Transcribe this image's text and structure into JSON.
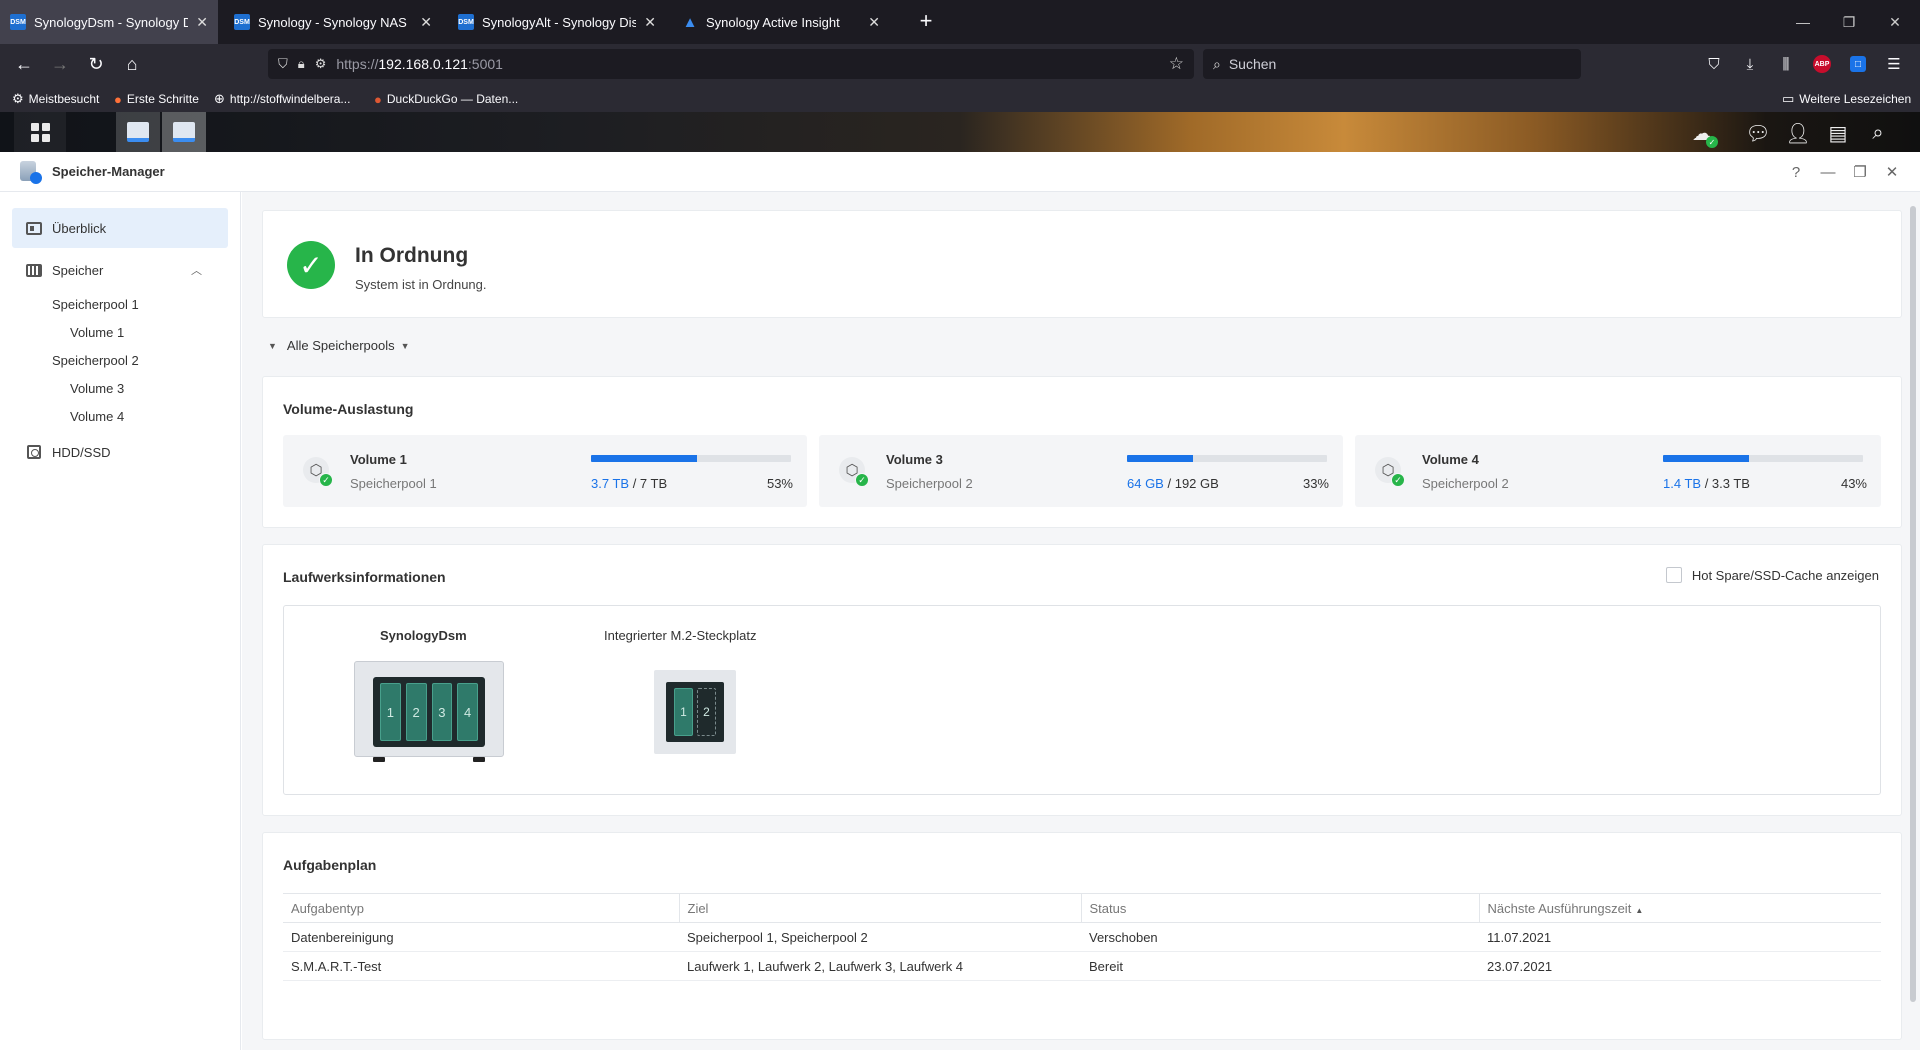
{
  "browser": {
    "tabs": [
      {
        "title": "SynologyDsm - Synology DiskStation",
        "icon": "DSM",
        "active": true
      },
      {
        "title": "Synology - Synology NAS",
        "icon": "DSM",
        "active": false
      },
      {
        "title": "SynologyAlt - Synology DiskStation",
        "icon": "DSM",
        "active": false
      },
      {
        "title": "Synology Active Insight",
        "icon": "insight-logo",
        "active": false
      }
    ],
    "url": {
      "scheme": "https://",
      "host": "192.168.0.121",
      "port": ":5001"
    },
    "search_placeholder": "Suchen",
    "bookmarks": [
      {
        "label": "Meistbesucht",
        "icon": "gear-icon"
      },
      {
        "label": "Erste Schritte",
        "icon": "firefox-icon"
      },
      {
        "label": "http://stoffwindelbera...",
        "icon": "globe-icon"
      },
      {
        "label": "DuckDuckGo — Daten...",
        "icon": "duckduckgo-icon"
      }
    ],
    "other_bookmarks": "Weitere Lesezeichen",
    "abp_label": "ABP"
  },
  "app": {
    "title": "Speicher-Manager"
  },
  "sidebar": {
    "overview": "Überblick",
    "storage": "Speicher",
    "pools": [
      {
        "label": "Speicherpool 1",
        "volumes": [
          "Volume 1"
        ]
      },
      {
        "label": "Speicherpool 2",
        "volumes": [
          "Volume 3",
          "Volume 4"
        ]
      }
    ],
    "hdd": "HDD/SSD"
  },
  "status": {
    "title": "In Ordnung",
    "subtitle": "System ist in Ordnung."
  },
  "pool_filter": "Alle Speicherpools",
  "volume_usage": {
    "title": "Volume-Auslastung",
    "volumes": [
      {
        "name": "Volume 1",
        "pool": "Speicherpool 1",
        "used": "3.7 TB",
        "total": "7 TB",
        "percent_label": "53%",
        "percent": 53
      },
      {
        "name": "Volume 3",
        "pool": "Speicherpool 2",
        "used": "64 GB",
        "total": "192 GB",
        "percent_label": "33%",
        "percent": 33
      },
      {
        "name": "Volume 4",
        "pool": "Speicherpool 2",
        "used": "1.4 TB",
        "total": "3.3 TB",
        "percent_label": "43%",
        "percent": 43
      }
    ]
  },
  "drives": {
    "title": "Laufwerksinformationen",
    "hotspare_label": "Hot Spare/SSD-Cache anzeigen",
    "nas_name": "SynologyDsm",
    "nas_bays": [
      "1",
      "2",
      "3",
      "4"
    ],
    "m2_name": "Integrierter M.2-Steckplatz",
    "m2_slots": [
      "1",
      "2"
    ]
  },
  "tasks": {
    "title": "Aufgabenplan",
    "headers": [
      "Aufgabentyp",
      "Ziel",
      "Status",
      "Nächste Ausführungszeit"
    ],
    "rows": [
      [
        "Datenbereinigung",
        "Speicherpool 1, Speicherpool 2",
        "Verschoben",
        "11.07.2021"
      ],
      [
        "S.M.A.R.T.-Test",
        "Laufwerk 1, Laufwerk 2, Laufwerk 3, Laufwerk 4",
        "Bereit",
        "23.07.2021"
      ]
    ]
  },
  "colors": {
    "accent": "#1a73e8",
    "ok_green": "#27b54a"
  }
}
